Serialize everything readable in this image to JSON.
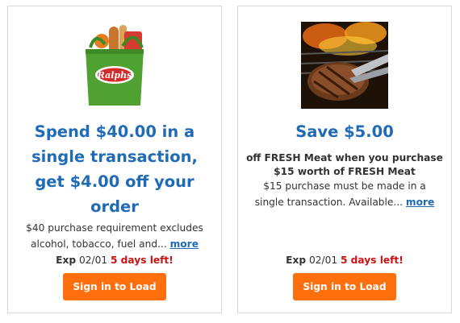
{
  "coupons": [
    {
      "image_alt": "Ralphs grocery bag",
      "brand_logo_text": "Ralphs",
      "headline_lines": [
        "Spend $40.00 in a",
        "single transaction,",
        "get $4.00 off your",
        "order"
      ],
      "description_lines": [
        "$40 purchase requirement excludes",
        "alcohol, tobacco, fuel and..."
      ],
      "more_label": "more",
      "exp_label": "Exp",
      "exp_date": "02/01",
      "days_left": "5 days left!",
      "button_label": "Sign in to Load"
    },
    {
      "image_alt": "Grilled steak with tongs",
      "headline_lines": [
        "Save $5.00"
      ],
      "subhead_lines": [
        "off FRESH Meat when you purchase",
        "$15 worth of FRESH Meat"
      ],
      "description_lines": [
        "$15 purchase must be made in a",
        "single transaction. Available..."
      ],
      "more_label": "more",
      "exp_label": "Exp",
      "exp_date": "02/01",
      "days_left": "5 days left!",
      "button_label": "Sign in to Load"
    }
  ],
  "colors": {
    "headline": "#1f6bb6",
    "link": "#1f6bb6",
    "urgent": "#cc1111",
    "button_bg": "#ff6f0e",
    "border": "#d9d9d9"
  }
}
